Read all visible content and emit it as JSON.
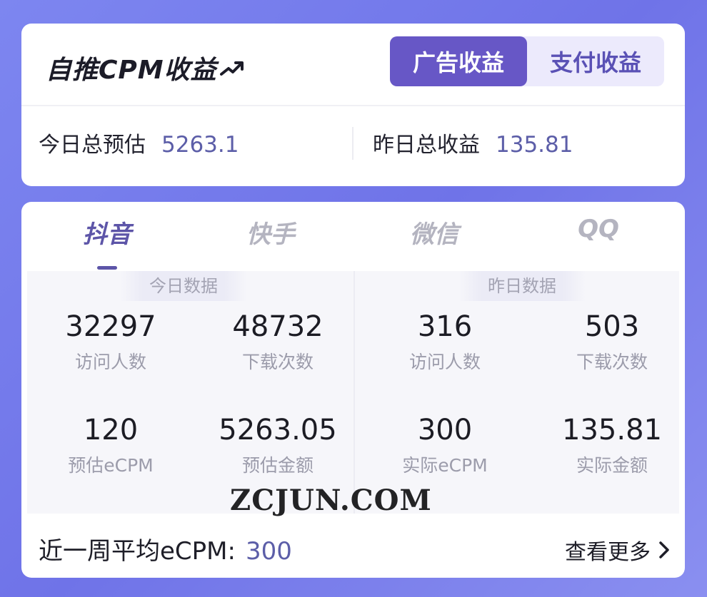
{
  "header": {
    "title": "自推CPM收益",
    "tabs": [
      {
        "label": "广告收益",
        "active": true
      },
      {
        "label": "支付收益",
        "active": false
      }
    ]
  },
  "summary": {
    "today": {
      "label": "今日总预估",
      "value": "5263.1"
    },
    "yesterday": {
      "label": "昨日总收益",
      "value": "135.81"
    }
  },
  "platform_tabs": [
    {
      "label": "抖音",
      "active": true
    },
    {
      "label": "快手",
      "active": false
    },
    {
      "label": "微信",
      "active": false
    },
    {
      "label": "QQ",
      "active": false
    }
  ],
  "today_panel": {
    "header": "今日数据",
    "stats": [
      {
        "value": "32297",
        "label": "访问人数"
      },
      {
        "value": "48732",
        "label": "下载次数"
      },
      {
        "value": "120",
        "label": "预估eCPM"
      },
      {
        "value": "5263.05",
        "label": "预估金额"
      }
    ]
  },
  "yesterday_panel": {
    "header": "昨日数据",
    "stats": [
      {
        "value": "316",
        "label": "访问人数"
      },
      {
        "value": "503",
        "label": "下载次数"
      },
      {
        "value": "300",
        "label": "实际eCPM"
      },
      {
        "value": "135.81",
        "label": "实际金额"
      }
    ]
  },
  "watermark": "ZCJUN.COM",
  "footer": {
    "weekly_label": "近一周平均eCPM:",
    "weekly_value": "300",
    "more_label": "查看更多"
  },
  "colors": {
    "accent": "#6757c6",
    "value_text": "#5c5ea8",
    "background": "#7d86f0"
  },
  "icons": {
    "title": "trend-up-arrow-icon",
    "more": "chevron-right-icon"
  }
}
